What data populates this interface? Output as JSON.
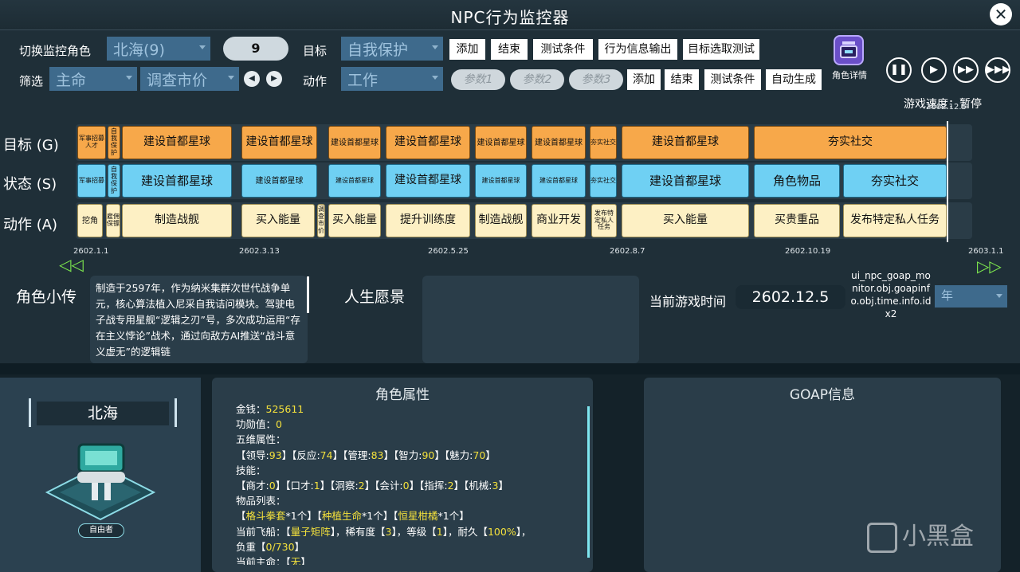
{
  "window": {
    "title": "NPC行为监控器"
  },
  "row1": {
    "switch_label": "切换监控角色",
    "character_value": "北海(9)",
    "id_value": "9",
    "goal_label": "目标",
    "goal_value": "自我保护",
    "buttons": [
      "添加",
      "结束",
      "测试条件",
      "行为信息输出",
      "目标选取测试"
    ]
  },
  "row2": {
    "filter_label": "筛选",
    "filter_value_1": "主命",
    "filter_value_2": "调查市价",
    "action_label": "动作",
    "action_value": "工作",
    "params": [
      "参数1",
      "参数2",
      "参数3"
    ],
    "buttons": [
      "添加",
      "结束",
      "测试条件",
      "自动生成"
    ]
  },
  "side": {
    "char_detail_label": "角色详情",
    "speed_label": "游戏速度：",
    "speed_value": "暂停",
    "clock_small": "2602.12.5"
  },
  "timeline": {
    "goal_label": "目标 (G)",
    "state_label": "状态 (S)",
    "action_label": "动作 (A)",
    "goals": [
      "军事招募人才",
      "自我保护",
      "建设首都星球",
      "建设首都星球",
      "建设首都星球",
      "建设首都星球",
      "建设首都星球",
      "建设首都星球",
      "夯实社交",
      "建设首都星球",
      "夯实社交"
    ],
    "states": [
      "军事招募",
      "自我保护",
      "建设首都星球",
      "建设首都星球",
      "建设首都星球",
      "建设首都星球",
      "建设首都星球",
      "建设首都星球",
      "夯实社交",
      "建设首都星球",
      "角色物品",
      "夯实社交"
    ],
    "actions": [
      "挖角",
      "雇佣保镖",
      "制造战舰",
      "买入能量",
      "调查市价",
      "买入能量",
      "提升训练度",
      "制造战舰",
      "商业开发",
      "发布特定私人任务",
      "买入能量",
      "买贵重品",
      "发布特定私人任务"
    ],
    "dates": [
      "2602.1.1",
      "2602.3.13",
      "2602.5.25",
      "2602.8.7",
      "2602.10.19",
      "2603.1.1"
    ]
  },
  "bio": {
    "title": "角色小传",
    "text": "制造于2597年，作为纳米集群次世代战争单元，核心算法植入尼采自我诘问模块。驾驶电子战专用星舰“逻辑之刃”号，多次成功运用“存在主义悖论”战术，通过向敌方AI推送“战斗意义虚无”的逻辑链"
  },
  "vision": {
    "title": "人生愿景"
  },
  "time": {
    "label": "当前游戏时间",
    "value": "2602.12.5",
    "debug": "ui_npc_goap_monitor.obj.goapinfo.obj.time.info.idx2",
    "unit": "年"
  },
  "portrait": {
    "name": "北海",
    "tag": "自由者"
  },
  "attributes": {
    "title": "角色属性",
    "money_label": "金钱：",
    "money": "525611",
    "merit_label": "功勋值：",
    "merit": "0",
    "five_label": "五维属性：",
    "five": [
      {
        "k": "领导",
        "v": "93"
      },
      {
        "k": "反应",
        "v": "74"
      },
      {
        "k": "管理",
        "v": "83"
      },
      {
        "k": "智力",
        "v": "90"
      },
      {
        "k": "魅力",
        "v": "70"
      }
    ],
    "skill_label": "技能：",
    "skills": [
      {
        "k": "商才",
        "v": "0"
      },
      {
        "k": "口才",
        "v": "1"
      },
      {
        "k": "洞察",
        "v": "2"
      },
      {
        "k": "会计",
        "v": "0"
      },
      {
        "k": "指挥",
        "v": "2"
      },
      {
        "k": "机械",
        "v": "3"
      }
    ],
    "items_label": "物品列表：",
    "items": [
      {
        "name": "格斗拳套",
        "count": "*1个"
      },
      {
        "name": "种植生命",
        "count": "*1个"
      },
      {
        "name": "恒星柑橘",
        "count": "*1个"
      }
    ],
    "ship_prefix": "当前飞船：【",
    "ship_name": "量子矩阵",
    "ship_mid1": "】，稀有度【",
    "ship_rarity": "3",
    "ship_mid2": "】，等级【",
    "ship_level": "1",
    "ship_mid3": "】，耐久【",
    "ship_dur": "100%",
    "ship_end": "】，",
    "load_prefix": "负重【",
    "load": "0/730",
    "load_end": "】",
    "lord_label": "当前主命：【",
    "lord": "无",
    "lord_end": "】"
  },
  "goap": {
    "title": "GOAP信息"
  },
  "watermark": {
    "text": "小黑盒"
  }
}
